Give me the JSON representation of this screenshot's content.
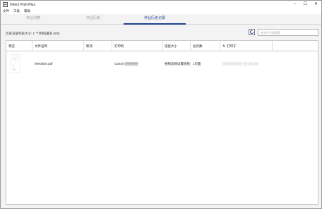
{
  "window": {
    "title": "Direct Print Plus",
    "minimize": "–",
    "maximize": "☐",
    "close": "✕"
  },
  "menu": [
    "文件",
    "工具",
    "帮助"
  ],
  "tabs": [
    {
      "label": "作业列表",
      "active": false
    },
    {
      "label": "作业历史",
      "active": false
    },
    {
      "label": "作业历史记录",
      "active": true
    }
  ],
  "history": {
    "count_label": "历史记录列表大小: 1 个项目(最多 500)",
    "search_placeholder": "按文件名称搜索"
  },
  "table": {
    "columns": [
      "预览",
      "文件名称",
      "取消",
      "打印机",
      "纸张大小",
      "总页数",
      "打印于"
    ],
    "rows": [
      {
        "file_name": "elevation.pdf",
        "cancel": "",
        "printer": "Canon ▒▒▒▒▒▒",
        "paper_size": "按照边缘设置纸张大小",
        "pages": "1页面",
        "printed_at": "▒▒▒▒/▒▒/▒▒ ▒▒:▒▒:▒▒"
      }
    ]
  },
  "colors": {
    "accent": "#1f3f8f",
    "inactive_tab": "#9a9a9a",
    "border": "#c9c9c9"
  },
  "icons": {
    "refresh": "refresh-icon",
    "sort": "sort-arrows-icon",
    "app": "printer-app-icon"
  }
}
